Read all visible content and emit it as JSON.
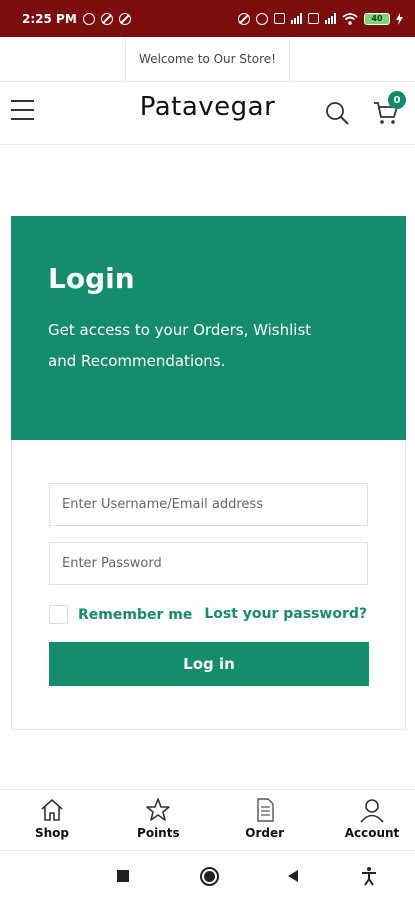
{
  "status_bar": {
    "time": "2:25 PM",
    "battery": "40",
    "background_color": "#7b0d0d"
  },
  "welcome": {
    "text": "Welcome to Our Store!"
  },
  "header": {
    "brand": "Patavegar",
    "cart_count": "0",
    "icons": [
      "menu-icon",
      "search-icon",
      "cart-icon"
    ]
  },
  "login": {
    "title": "Login",
    "subtitle_line1": "Get access to your Orders, Wishlist",
    "subtitle_line2": "and Recommendations.",
    "username_placeholder": "Enter Username/Email address",
    "password_placeholder": "Enter Password",
    "remember_label": "Remember me",
    "lost_password": "Lost your password?",
    "button_label": "Log in",
    "accent_color": "#158c6b"
  },
  "bottom_nav": {
    "items": [
      {
        "label": "Shop",
        "icon": "home-icon"
      },
      {
        "label": "Points",
        "icon": "star-icon"
      },
      {
        "label": "Order",
        "icon": "document-icon"
      },
      {
        "label": "Account",
        "icon": "user-icon"
      }
    ]
  },
  "system_nav": {
    "icons": [
      "recents-icon",
      "home-circle-icon",
      "back-icon",
      "accessibility-icon"
    ]
  }
}
